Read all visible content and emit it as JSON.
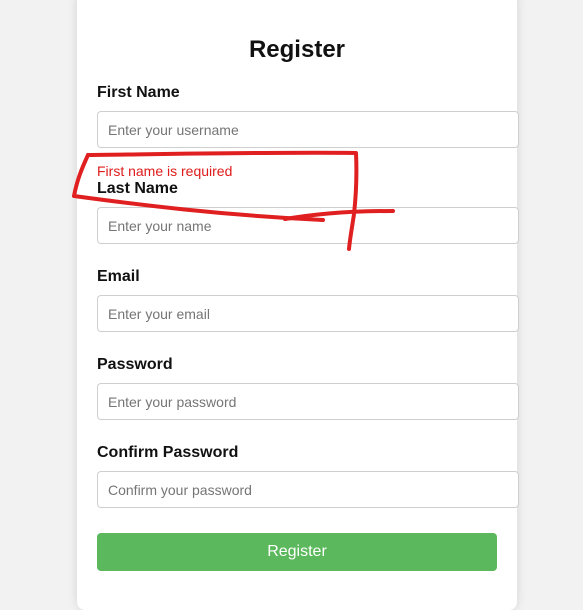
{
  "form": {
    "title": "Register",
    "fields": [
      {
        "label": "First Name",
        "placeholder": "Enter your username",
        "value": ""
      },
      {
        "label": "Last Name",
        "placeholder": "Enter your name",
        "value": ""
      },
      {
        "label": "Email",
        "placeholder": "Enter your email",
        "value": ""
      },
      {
        "label": "Password",
        "placeholder": "Enter your password",
        "value": ""
      },
      {
        "label": "Confirm Password",
        "placeholder": "Confirm your password",
        "value": ""
      }
    ],
    "error_first_name": "First name is required",
    "submit_label": "Register"
  },
  "colors": {
    "error": "#e01b1b",
    "button": "#5cb85c",
    "annotation": "#e02020"
  }
}
